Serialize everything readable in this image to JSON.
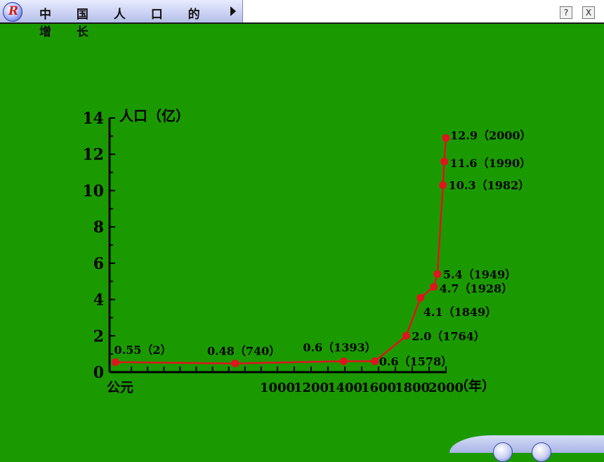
{
  "window": {
    "title": "中 国 人 口 的 增 长",
    "logo_letter": "R",
    "help_label": "?",
    "close_label": "X",
    "bottom_text": ""
  },
  "icons": {
    "logo": "app-logo-icon",
    "next": "play-triangle-icon",
    "help": "help-icon",
    "close": "close-icon",
    "play": "play-icon",
    "stop": "stop-icon"
  },
  "colors": {
    "background": "#1b9a00",
    "series": "#e0141e",
    "axis": "#000000"
  },
  "chart_data": {
    "type": "line",
    "title": "",
    "ylabel": "人口（亿）",
    "xlabel": "（年）",
    "ylim": [
      0,
      14
    ],
    "yticks": [
      0,
      2,
      4,
      6,
      8,
      10,
      12,
      14
    ],
    "xorigin_label": "公元",
    "xticks": [
      {
        "year": 1000,
        "label": "1000"
      },
      {
        "year": 1200,
        "label": "1200"
      },
      {
        "year": 1400,
        "label": "1400"
      },
      {
        "year": 1600,
        "label": "1600"
      },
      {
        "year": 1800,
        "label": "1800"
      },
      {
        "year": 2000,
        "label": "2000"
      }
    ],
    "series": [
      {
        "points": [
          {
            "year": 2,
            "value": 0.55,
            "label": "0.55（2）"
          },
          {
            "year": 740,
            "value": 0.48,
            "label": "0.48（740）"
          },
          {
            "year": 1393,
            "value": 0.6,
            "label": "0.6（1393）"
          },
          {
            "year": 1578,
            "value": 0.6,
            "label": "0.6（1578）"
          },
          {
            "year": 1764,
            "value": 2.0,
            "label": "2.0（1764）"
          },
          {
            "year": 1849,
            "value": 4.1,
            "label": "4.1（1849）"
          },
          {
            "year": 1928,
            "value": 4.7,
            "label": "4.7（1928）"
          },
          {
            "year": 1949,
            "value": 5.4,
            "label": "5.4（1949）"
          },
          {
            "year": 1982,
            "value": 10.3,
            "label": "10.3（1982）"
          },
          {
            "year": 1990,
            "value": 11.6,
            "label": "11.6（1990）"
          },
          {
            "year": 2000,
            "value": 12.9,
            "label": "12.9（2000）"
          }
        ]
      }
    ]
  }
}
